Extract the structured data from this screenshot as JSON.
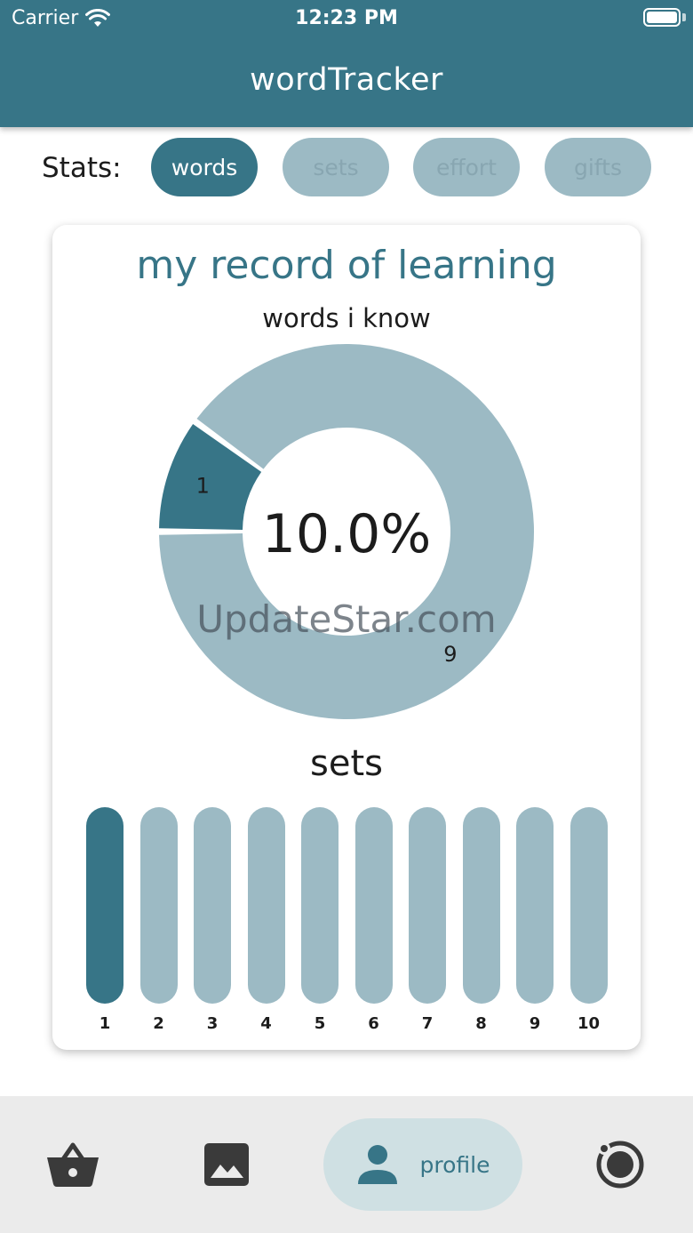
{
  "status_bar": {
    "carrier": "Carrier",
    "time": "12:23 PM"
  },
  "header": {
    "title": "wordTracker"
  },
  "stats": {
    "label": "Stats:",
    "tabs": [
      {
        "label": "words",
        "active": true
      },
      {
        "label": "sets",
        "active": false
      },
      {
        "label": "effort",
        "active": false
      },
      {
        "label": "gifts",
        "active": false
      }
    ]
  },
  "card": {
    "title": "my record of learning",
    "donut_title": "words i know",
    "center_value": "10.0%",
    "sets_title": "sets"
  },
  "chart_data": [
    {
      "type": "pie",
      "title": "words i know",
      "values": [
        1,
        9
      ],
      "labels": [
        "1",
        "9"
      ],
      "center_label": "10.0%",
      "colors": [
        "#377587",
        "#9cbac4"
      ]
    },
    {
      "type": "bar",
      "title": "sets",
      "categories": [
        "1",
        "2",
        "3",
        "4",
        "5",
        "6",
        "7",
        "8",
        "9",
        "10"
      ],
      "completed": [
        true,
        false,
        false,
        false,
        false,
        false,
        false,
        false,
        false,
        false
      ],
      "colors": {
        "completed": "#377587",
        "incomplete": "#9cbac4"
      }
    }
  ],
  "watermark": "UpdateStar.com",
  "bottom_nav": {
    "items": [
      {
        "icon": "basket-icon",
        "label": "",
        "active": false
      },
      {
        "icon": "image-icon",
        "label": "",
        "active": false
      },
      {
        "icon": "person-icon",
        "label": "profile",
        "active": true
      },
      {
        "icon": "record-icon",
        "label": "",
        "active": false
      }
    ]
  },
  "colors": {
    "primary": "#377587",
    "muted": "#9cbac4",
    "nav_active_bg": "#cfe0e3",
    "nav_bg": "#ebebeb"
  }
}
